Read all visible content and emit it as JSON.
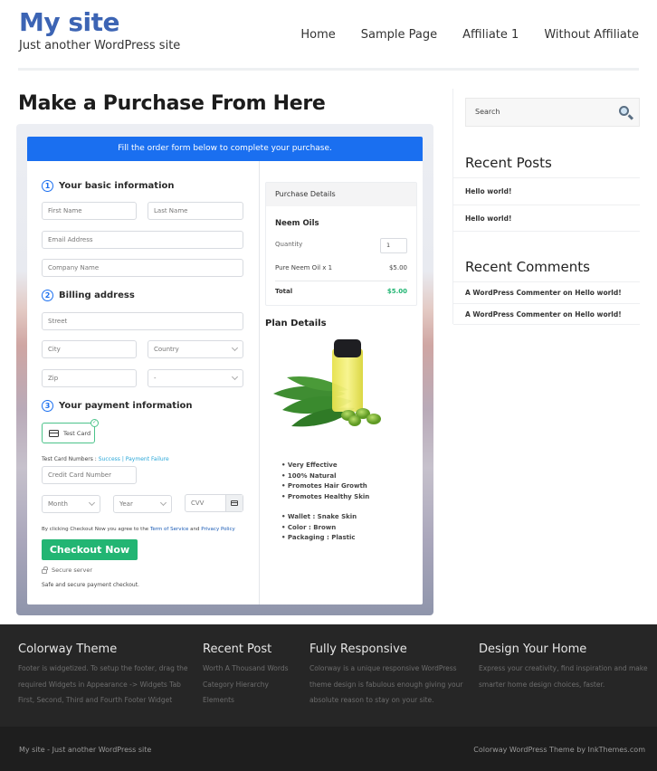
{
  "header": {
    "site_title": "My site",
    "tagline": "Just another WordPress site",
    "nav": [
      "Home",
      "Sample Page",
      "Affiliate 1",
      "Without Affiliate"
    ]
  },
  "page": {
    "title": "Make a Purchase From Here"
  },
  "form": {
    "banner": "Fill the order form below to complete your purchase.",
    "step1": {
      "num": "1",
      "title": "Your basic information"
    },
    "first_name_placeholder": "First Name",
    "last_name_placeholder": "Last Name",
    "email_placeholder": "Email Address",
    "company_placeholder": "Company Name",
    "step2": {
      "num": "2",
      "title": "Billing address"
    },
    "street_placeholder": "Street",
    "city_placeholder": "City",
    "country_placeholder": "Country",
    "zip_placeholder": "Zip",
    "state_placeholder": "-",
    "step3": {
      "num": "3",
      "title": "Your payment information"
    },
    "payment_method": "Test Card",
    "test_card_label": "Test Card Numbers :",
    "test_success": "Success",
    "test_sep": "|",
    "test_failure": "Payment Failure",
    "cc_placeholder": "Credit Card Number",
    "month_placeholder": "Month",
    "year_placeholder": "Year",
    "cvv_placeholder": "CVV",
    "terms_prefix": "By clicking Checkout Now you agree to the",
    "terms_link": "Term of Service",
    "terms_and": "and",
    "privacy_link": "Privacy Policy",
    "checkout_button": "Checkout Now",
    "secure_label": "Secure server",
    "safe_text": "Safe and secure payment checkout."
  },
  "purchase": {
    "heading": "Purchase Details",
    "product": "Neem Oils",
    "quantity_label": "Quantity",
    "quantity": "1",
    "line_item": "Pure Neem Oil x 1",
    "line_price": "$5.00",
    "total_label": "Total",
    "total": "$5.00",
    "accent_color": "#22b573"
  },
  "plan": {
    "title": "Plan Details",
    "features": [
      "Very Effective",
      "100% Natural",
      "Promotes Hair Growth",
      "Promotes Healthy Skin"
    ],
    "specs": [
      "Wallet : Snake Skin",
      "Color : Brown",
      "Packaging : Plastic"
    ]
  },
  "sidebar": {
    "search_placeholder": "Search",
    "recent_posts_title": "Recent Posts",
    "recent_posts": [
      "Hello world!",
      "Hello world!"
    ],
    "recent_comments_title": "Recent Comments",
    "recent_comments": [
      "A WordPress Commenter on Hello world!",
      "A WordPress Commenter on Hello world!"
    ]
  },
  "footer": {
    "cols": [
      {
        "title": "Colorway Theme",
        "lines": [
          "Footer is widgetized. To setup the footer, drag the",
          "required Widgets in Appearance -> Widgets Tab",
          "First, Second, Third and Fourth Footer Widget"
        ]
      },
      {
        "title": "Recent Post",
        "lines": [
          "Worth A Thousand Words",
          "Category Hierarchy",
          "Elements"
        ]
      },
      {
        "title": "Fully Responsive",
        "lines": [
          "Colorway is a unique responsive WordPress",
          "theme design is fabulous enough giving your",
          "absolute reason to stay on your site."
        ]
      },
      {
        "title": "Design Your Home",
        "lines": [
          "Express your creativity, find inspiration and make",
          "smarter home design choices, faster."
        ]
      }
    ],
    "bottom_left": "My site - Just another WordPress site",
    "bottom_right": "Colorway WordPress Theme by InkThemes.com"
  },
  "colors": {
    "brand_blue": "#3c64b4",
    "banner_blue": "#1a6ff0",
    "checkout_green": "#22b573"
  }
}
